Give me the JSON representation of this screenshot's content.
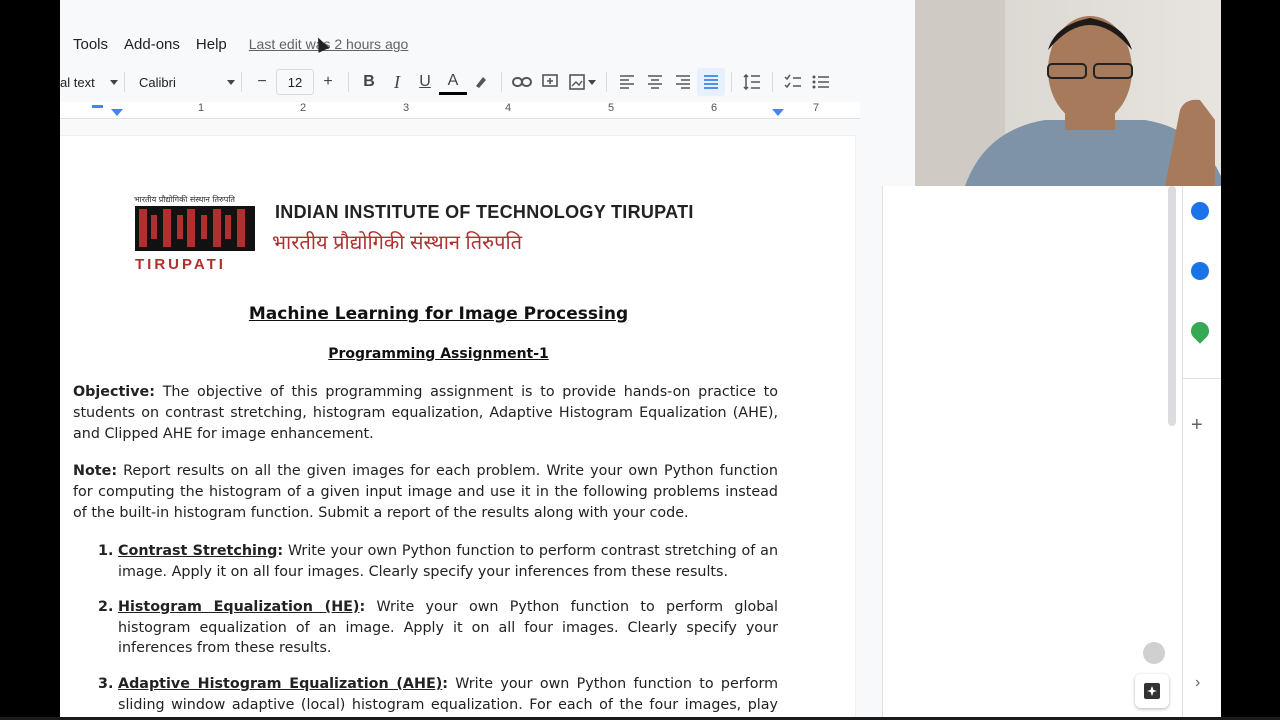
{
  "menu": {
    "items": [
      "Tools",
      "Add-ons",
      "Help"
    ],
    "last_edit": "Last edit was 2 hours ago"
  },
  "toolbar": {
    "style_select": "al text",
    "font_select": "Calibri",
    "decrease_size": "−",
    "font_size": "12",
    "increase_size": "+",
    "bold": "B",
    "italic": "I",
    "underline": "U",
    "text_color": "A"
  },
  "ruler": {
    "ticks": [
      "1",
      "2",
      "3",
      "4",
      "5",
      "6",
      "7"
    ]
  },
  "document": {
    "institute_en": "INDIAN INSTITUTE OF TECHNOLOGY TIRUPATI",
    "institute_hi": "भारतीय प्रौद्योगिकी संस्थान तिरुपति",
    "logo_text_hi": "भारतीय प्रौद्योगिकी संस्थान तिरुपति",
    "logo_text_en": "TIRUPATI",
    "title": "Machine Learning for Image Processing",
    "subtitle": "Programming Assignment-1",
    "objective_label": "Objective:",
    "objective_text": "The objective of this programming assignment is to provide hands-on practice to students on contrast stretching, histogram equalization, Adaptive Histogram Equalization (AHE), and Clipped AHE for image enhancement.",
    "note_label": "Note:",
    "note_text": "Report results on all the given images for each problem. Write your own Python function for computing the histogram of a given input image and use it in the following problems instead of the built-in histogram function. Submit a report of the results along with your code.",
    "items": [
      {
        "num": "1.",
        "term": "Contrast Stretching",
        "sep": ":",
        "text": " Write your own Python function to perform contrast stretching of an image. Apply it on all four images. Clearly specify your inferences from these results."
      },
      {
        "num": "2.",
        "term": "Histogram Equalization (HE)",
        "sep": ":",
        "text": " Write your own Python function to perform global histogram equalization of an image. Apply it on all four images. Clearly specify your inferences from these results."
      },
      {
        "num": "3.",
        "term": "Adaptive Histogram Equalization (AHE)",
        "sep": ":",
        "text": " Write your own Python function to perform sliding window adaptive (local) histogram equalization. For each of the four images, play with varying"
      }
    ]
  },
  "colors": {
    "accent_blue": "#1a73e8",
    "logo_red": "#b03030"
  }
}
